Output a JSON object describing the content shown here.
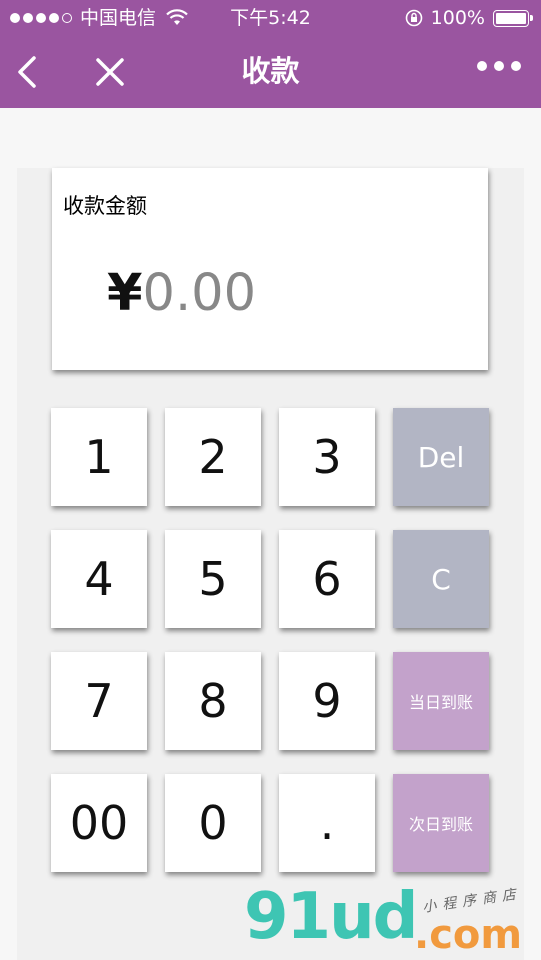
{
  "status_bar": {
    "carrier": "中国电信",
    "time": "下午5:42",
    "battery": "100%"
  },
  "nav": {
    "title": "收款"
  },
  "amount": {
    "label": "收款金额",
    "currency": "¥",
    "value": "0.00"
  },
  "keypad": {
    "keys": [
      "1",
      "2",
      "3",
      "4",
      "5",
      "6",
      "7",
      "8",
      "9",
      "00",
      "0",
      "."
    ],
    "del": "Del",
    "clear": "C",
    "same_day": "当日到账",
    "next_day": "次日到账"
  },
  "watermark": {
    "brand": "91ud",
    "domain": ".com",
    "tagline": "小程序商店"
  },
  "colors": {
    "header": "#9a55a0",
    "gray_key": "#b2b5c4",
    "purple_key": "#c3a2cb",
    "amount_placeholder": "#888888"
  }
}
